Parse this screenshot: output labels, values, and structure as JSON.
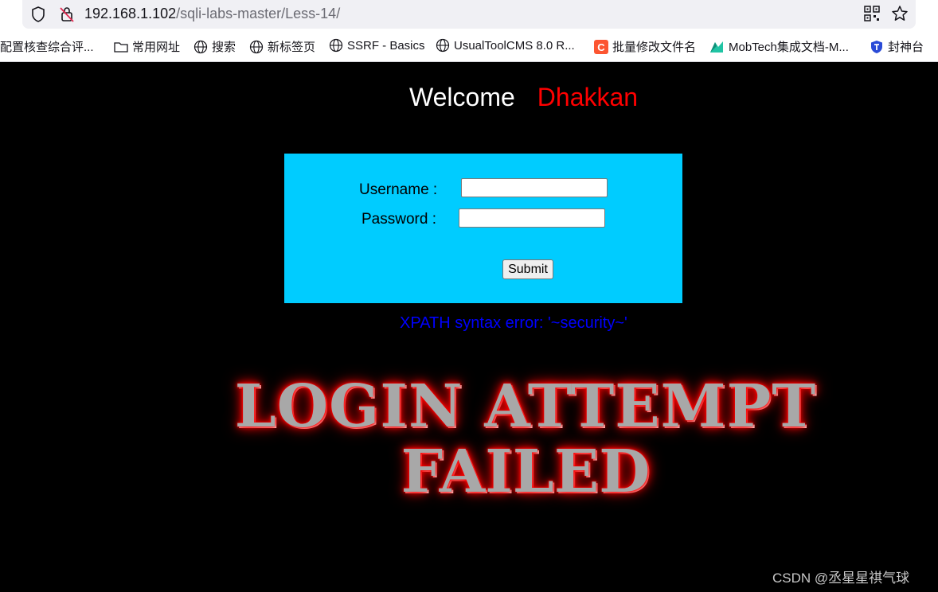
{
  "browser": {
    "url_host": "192.168.1.102",
    "url_path": "/sqli-labs-master/Less-14/",
    "bookmarks": [
      {
        "label": "配置核查综合评...",
        "icon": "none"
      },
      {
        "label": "常用网址",
        "icon": "folder-icon"
      },
      {
        "label": "搜索",
        "icon": "globe-icon"
      },
      {
        "label": "新标签页",
        "icon": "globe-icon"
      },
      {
        "label": "SSRF - Basics",
        "icon": "globe-icon"
      },
      {
        "label": "UsualToolCMS 8.0 R...",
        "icon": "globe-icon"
      },
      {
        "label": "批量修改文件名",
        "icon": "csdn-icon"
      },
      {
        "label": "MobTech集成文档-M...",
        "icon": "mobtech-icon"
      },
      {
        "label": "封神台",
        "icon": "shield-logo-icon"
      }
    ]
  },
  "page": {
    "welcome_label": "Welcome",
    "welcome_name": "Dhakkan",
    "form": {
      "username_label": "Username :",
      "username_value": "",
      "password_label": "Password :",
      "password_value": "",
      "submit_label": "Submit"
    },
    "error_message": "XPATH syntax error: '~security~'",
    "failure_line1": "LOGIN ATTEMPT",
    "failure_line2": "FAILED",
    "watermark": "CSDN @丞星星祺气球"
  },
  "colors": {
    "page_bg": "#000000",
    "form_bg": "#00ccff",
    "welcome_name": "#ff0000",
    "error_text": "#0000ff"
  }
}
